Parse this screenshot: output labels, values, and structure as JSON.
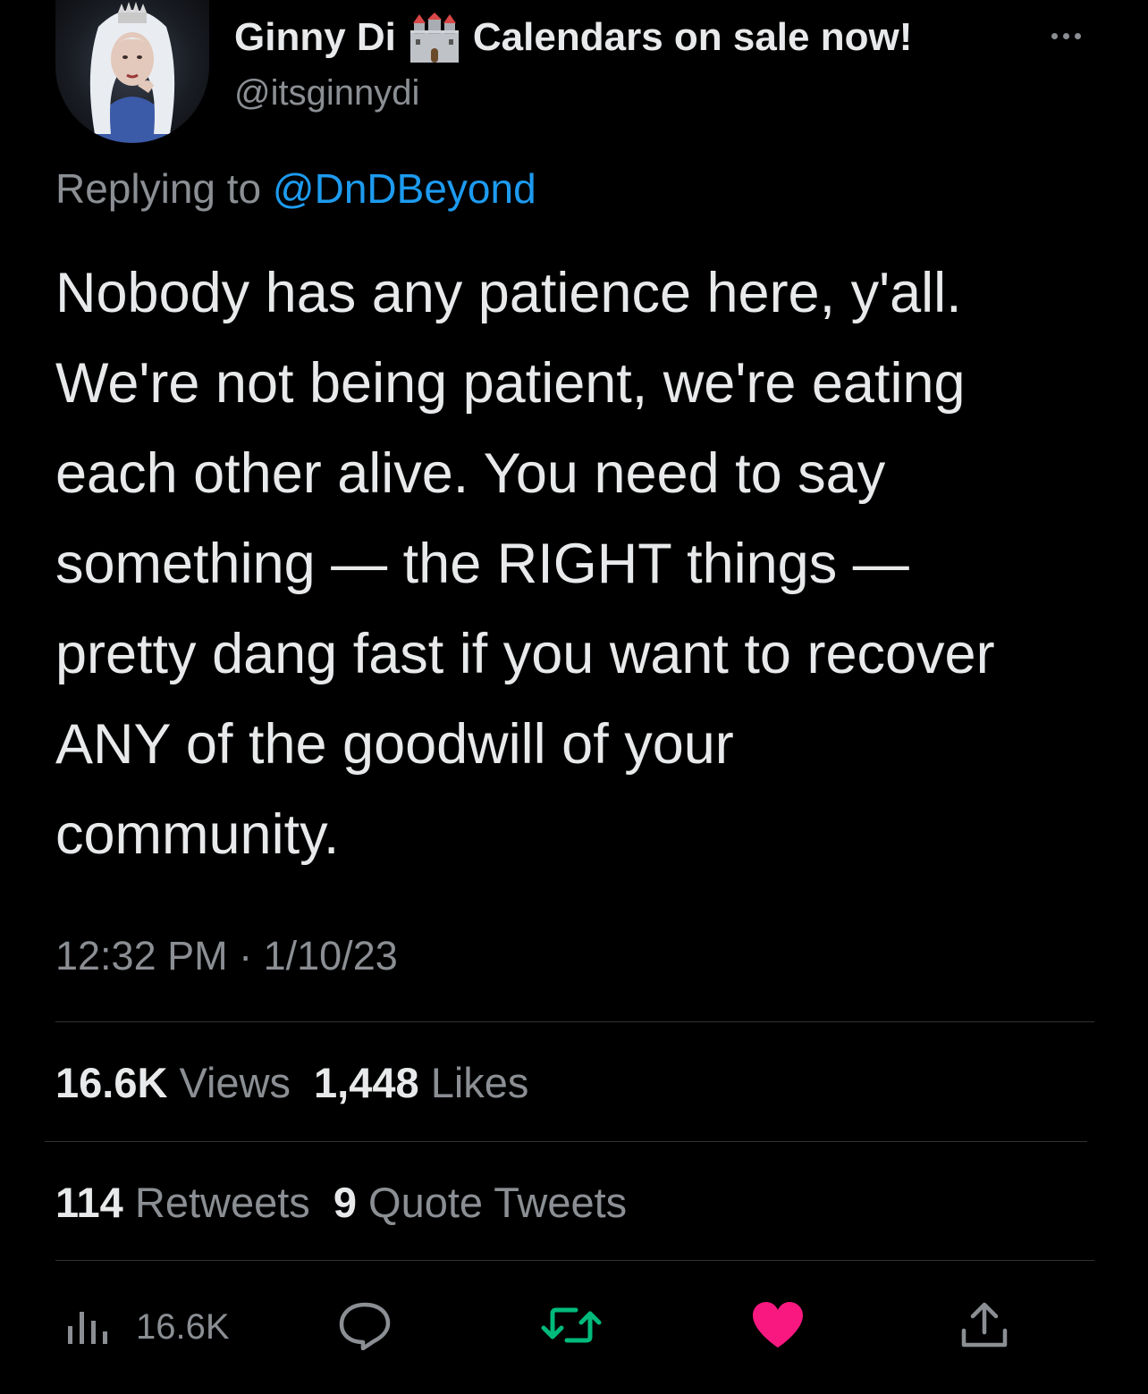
{
  "author": {
    "display_name": "Ginny Di",
    "name_suffix": "Calendars on sale now!",
    "name_emoji": "castle-icon",
    "handle": "@itsginnydi"
  },
  "reply": {
    "prefix": "Replying to ",
    "mention": "@DnDBeyond"
  },
  "tweet": {
    "lines": [
      "Nobody has any patience here, y'all.",
      "We're not being patient, we're eating",
      "each other alive. You need to say",
      "something — the RIGHT things —",
      "pretty dang fast if you want to recover",
      "ANY of the goodwill of your",
      "community."
    ],
    "timestamp": "12:32 PM · 1/10/23"
  },
  "stats": {
    "views_count": "16.6K",
    "views_label": "Views",
    "likes_count": "1,448",
    "likes_label": "Likes",
    "retweets_count": "114",
    "retweets_label": "Retweets",
    "quotes_count": "9",
    "quotes_label": "Quote Tweets"
  },
  "actions": {
    "views_count": "16.6K",
    "icons": [
      "views-icon",
      "reply-icon",
      "retweet-icon",
      "like-icon",
      "share-icon"
    ],
    "retweet_color": "#00ba7c",
    "like_color": "#f91880"
  },
  "colors": {
    "background": "#000000",
    "text": "#e7e9ea",
    "secondary": "#8b8f94",
    "link": "#1d9bf0"
  }
}
